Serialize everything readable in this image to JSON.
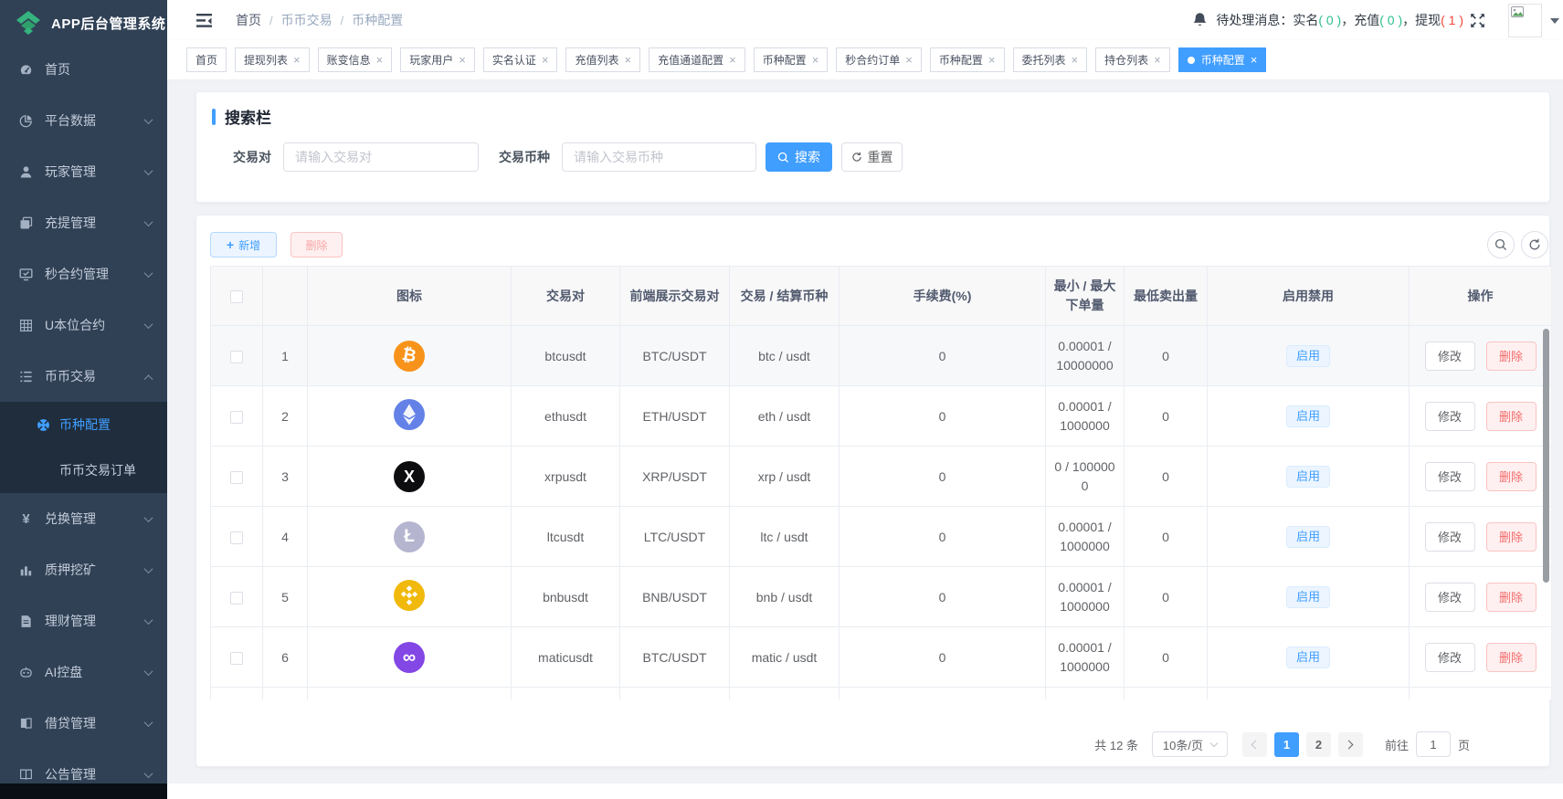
{
  "app": {
    "title": "APP后台管理系统"
  },
  "topbar": {
    "breadcrumb": [
      {
        "label": "首页",
        "dim": false
      },
      {
        "label": "币币交易",
        "dim": true
      },
      {
        "label": "币种配置",
        "dim": true
      }
    ],
    "notice": {
      "prefix": "待处理消息：",
      "separator": "，",
      "items": [
        {
          "label": "实名",
          "count": "0",
          "color": "#2cbe8c"
        },
        {
          "label": "充值",
          "count": "0",
          "color": "#2cbe8c"
        },
        {
          "label": "提现",
          "count": "1",
          "color": "#f5483b"
        }
      ]
    }
  },
  "tabs": [
    {
      "key": "home",
      "label": "首页",
      "closable": false,
      "active": false
    },
    {
      "key": "withdraw-list",
      "label": "提现列表",
      "closable": true,
      "active": false
    },
    {
      "key": "account-change",
      "label": "账变信息",
      "closable": true,
      "active": false
    },
    {
      "key": "player-user",
      "label": "玩家用户",
      "closable": true,
      "active": false
    },
    {
      "key": "realname-auth",
      "label": "实名认证",
      "closable": true,
      "active": false
    },
    {
      "key": "recharge-list",
      "label": "充值列表",
      "closable": true,
      "active": false
    },
    {
      "key": "recharge-channel-config",
      "label": "充值通道配置",
      "closable": true,
      "active": false
    },
    {
      "key": "coin-config-1",
      "label": "币种配置",
      "closable": true,
      "active": false
    },
    {
      "key": "seconds-contract-order",
      "label": "秒合约订单",
      "closable": true,
      "active": false
    },
    {
      "key": "coin-config-2",
      "label": "币种配置",
      "closable": true,
      "active": false
    },
    {
      "key": "entrust-list",
      "label": "委托列表",
      "closable": true,
      "active": false
    },
    {
      "key": "position-list",
      "label": "持仓列表",
      "closable": true,
      "active": false
    },
    {
      "key": "coin-config-active",
      "label": "币种配置",
      "closable": true,
      "active": true
    }
  ],
  "sidebar": {
    "items": [
      {
        "key": "home",
        "icon": "dashboard",
        "label": "首页",
        "arrow": false
      },
      {
        "key": "platform-data",
        "icon": "pie",
        "label": "平台数据",
        "arrow": true
      },
      {
        "key": "player-manage",
        "icon": "user",
        "label": "玩家管理",
        "arrow": true
      },
      {
        "key": "recharge-withdraw-manage",
        "icon": "money",
        "label": "充提管理",
        "arrow": true
      },
      {
        "key": "seconds-contract-manage",
        "icon": "monitor",
        "label": "秒合约管理",
        "arrow": true
      },
      {
        "key": "u-contract",
        "icon": "grid",
        "label": "U本位合约",
        "arrow": true
      },
      {
        "key": "coin-trade",
        "icon": "list",
        "label": "币币交易",
        "arrow": true,
        "expanded": true,
        "children": [
          {
            "key": "coin-config",
            "icon": "coin",
            "label": "币种配置",
            "active": true
          },
          {
            "key": "coin-trade-orders",
            "icon": "",
            "label": "币币交易订单",
            "active": false
          }
        ]
      },
      {
        "key": "exchange-manage",
        "icon": "yen",
        "label": "兑换管理",
        "arrow": true
      },
      {
        "key": "staking-mining",
        "icon": "bars",
        "label": "质押挖矿",
        "arrow": true
      },
      {
        "key": "wealth-manage",
        "icon": "doc",
        "label": "理财管理",
        "arrow": true
      },
      {
        "key": "ai-control",
        "icon": "robot",
        "label": "AI控盘",
        "arrow": true
      },
      {
        "key": "loan-manage",
        "icon": "book",
        "label": "借贷管理",
        "arrow": true
      },
      {
        "key": "announcement-manage",
        "icon": "openbook",
        "label": "公告管理",
        "arrow": true
      }
    ]
  },
  "search": {
    "title": "搜索栏",
    "fields": [
      {
        "label": "交易对",
        "placeholder": "请输入交易对"
      },
      {
        "label": "交易币种",
        "placeholder": "请输入交易币种"
      }
    ],
    "search_label": "搜索",
    "reset_label": "重置"
  },
  "toolbar": {
    "add_label": "新增",
    "delete_label": "删除"
  },
  "table": {
    "columns": [
      "",
      "",
      "图标",
      "交易对",
      "前端展示交易对",
      "交易 / 结算币种",
      "手续费(%)",
      "最小 / 最大下单量",
      "最低卖出量",
      "启用禁用",
      "操作"
    ],
    "enable_label": "启用",
    "edit_label": "修改",
    "delete_label": "删除",
    "rows": [
      {
        "index": "1",
        "coin": "btc",
        "color": "#f7931a",
        "pair": "btcusdt",
        "display_pair": "BTC/USDT",
        "trade_settle": "btc / usdt",
        "fee": "0",
        "min_max": "0.00001 / 10000000",
        "min_sell": "0",
        "status": "启用"
      },
      {
        "index": "2",
        "coin": "eth",
        "color": "#6481e7",
        "pair": "ethusdt",
        "display_pair": "ETH/USDT",
        "trade_settle": "eth / usdt",
        "fee": "0",
        "min_max": "0.00001 / 1000000",
        "min_sell": "0",
        "status": "启用"
      },
      {
        "index": "3",
        "coin": "xrp",
        "color": "#0d0d10",
        "pair": "xrpusdt",
        "display_pair": "XRP/USDT",
        "trade_settle": "xrp / usdt",
        "fee": "0",
        "min_max": "0 / 1000000",
        "min_sell": "0",
        "status": "启用"
      },
      {
        "index": "4",
        "coin": "ltc",
        "color": "#b5b5d0",
        "pair": "ltcusdt",
        "display_pair": "LTC/USDT",
        "trade_settle": "ltc / usdt",
        "fee": "0",
        "min_max": "0.00001 / 1000000",
        "min_sell": "0",
        "status": "启用"
      },
      {
        "index": "5",
        "coin": "bnb",
        "color": "#f0b90b",
        "pair": "bnbusdt",
        "display_pair": "BNB/USDT",
        "trade_settle": "bnb / usdt",
        "fee": "0",
        "min_max": "0.00001 / 1000000",
        "min_sell": "0",
        "status": "启用"
      },
      {
        "index": "6",
        "coin": "matic",
        "color": "#8247e5",
        "pair": "maticusdt",
        "display_pair": "BTC/USDT",
        "trade_settle": "matic / usdt",
        "fee": "0",
        "min_max": "0.00001 / 1000000",
        "min_sell": "0",
        "status": "启用"
      }
    ]
  },
  "pagination": {
    "total": "共 12 条",
    "page_size": "10条/页",
    "pages": [
      "1",
      "2"
    ],
    "active_page": "1",
    "goto_label": "前往",
    "goto_value": "1",
    "page_label": "页"
  }
}
